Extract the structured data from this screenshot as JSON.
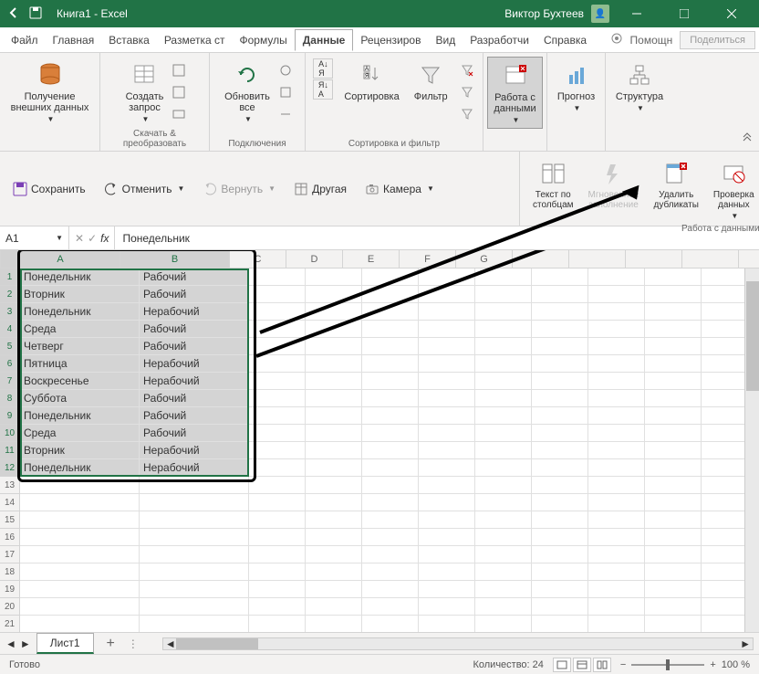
{
  "titlebar": {
    "title": "Книга1 - Excel",
    "user": "Виктор Бухтеев"
  },
  "menu": {
    "items": [
      "Файл",
      "Главная",
      "Вставка",
      "Разметка ст",
      "Формулы",
      "Данные",
      "Рецензиров",
      "Вид",
      "Разработчи",
      "Справка"
    ],
    "active_index": 5,
    "help": "Помощн",
    "share": "Поделиться"
  },
  "ribbon": {
    "get_data": "Получение\nвнешних данных",
    "create_query": "Создать\nзапрос",
    "download_transform": "Скачать & преобразовать",
    "refresh": "Обновить\nвсе",
    "connections": "Подключения",
    "sort": "Сортировка",
    "filter": "Фильтр",
    "sort_filter": "Сортировка и фильтр",
    "data_tools": "Работа с\nданными",
    "forecast": "Прогноз",
    "structure": "Структура"
  },
  "tools_panel": {
    "save": "Сохранить",
    "undo": "Отменить",
    "redo": "Вернуть",
    "other": "Другая",
    "camera": "Камера",
    "text_to_cols": "Текст по\nстолбцам",
    "flash_fill": "Мгновенное\nзаполнение",
    "remove_dups": "Удалить\nдубликаты",
    "validation": "Проверка\nданных",
    "group_label": "Работа с данными"
  },
  "formula": {
    "cell": "A1",
    "value": "Понедельник"
  },
  "columns": [
    "A",
    "B",
    "C",
    "D",
    "E",
    "F",
    "G"
  ],
  "rows_visible": 21,
  "table": [
    {
      "a": "Понедельник",
      "b": "Рабочий"
    },
    {
      "a": "Вторник",
      "b": "Рабочий"
    },
    {
      "a": "Понедельник",
      "b": "Нерабочий"
    },
    {
      "a": "Среда",
      "b": "Рабочий"
    },
    {
      "a": "Четверг",
      "b": "Рабочий"
    },
    {
      "a": "Пятница",
      "b": "Нерабочий"
    },
    {
      "a": "Воскресенье",
      "b": "Нерабочий"
    },
    {
      "a": "Суббота",
      "b": "Рабочий"
    },
    {
      "a": "Понедельник",
      "b": "Рабочий"
    },
    {
      "a": "Среда",
      "b": "Рабочий"
    },
    {
      "a": "Вторник",
      "b": "Нерабочий"
    },
    {
      "a": "Понедельник",
      "b": "Нерабочий"
    }
  ],
  "sheet": {
    "name": "Лист1"
  },
  "status": {
    "ready": "Готово",
    "count_label": "Количество:",
    "count": "24",
    "zoom": "100 %"
  }
}
